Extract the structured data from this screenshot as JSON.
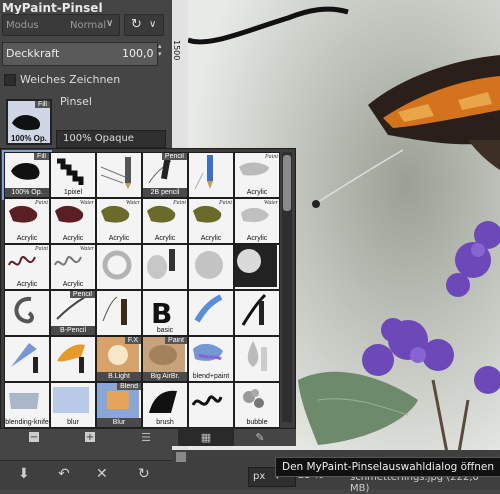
{
  "dock": {
    "title": "MyPaint-Pinsel",
    "mode_label": "Modus",
    "mode_value": "Normal",
    "opacity_label": "Deckkraft",
    "opacity_value": "100,0",
    "soft_label": "Weiches Zeichnen",
    "brush_label": "Pinsel",
    "current_brush_name": "100% Opaque"
  },
  "ruler": {
    "value": "1500"
  },
  "brushes": [
    {
      "label": "100% Op.",
      "badge": "Fill",
      "dark": true,
      "selected": true,
      "icon": "fill-black-icon"
    },
    {
      "label": "1pixel",
      "badge": "",
      "dark": false,
      "icon": "pixel-steps-icon"
    },
    {
      "label": "",
      "badge": "",
      "dark": false,
      "icon": "pencil-strokes-icon"
    },
    {
      "label": "2B pencil",
      "badge": "Pencil",
      "dark": true,
      "icon": "pencil-icon"
    },
    {
      "label": "",
      "badge": "",
      "dark": false,
      "icon": "blue-pencil-icon"
    },
    {
      "label": "Acrylic",
      "badge": "Paint",
      "dark": false,
      "icon": "acrylic-icon"
    },
    {
      "label": "Acrylic",
      "badge": "Paint",
      "dark": false,
      "icon": "acrylic-maroon-icon"
    },
    {
      "label": "Acrylic",
      "badge": "Water",
      "dark": false,
      "icon": "acrylic-maroon-icon"
    },
    {
      "label": "Acrylic",
      "badge": "Water",
      "dark": false,
      "icon": "acrylic-olive-icon"
    },
    {
      "label": "Acrylic",
      "badge": "Paint",
      "dark": false,
      "icon": "acrylic-olive-icon"
    },
    {
      "label": "Acrylic",
      "badge": "Paint",
      "dark": false,
      "icon": "acrylic-olive-icon"
    },
    {
      "label": "Acrylic",
      "badge": "Water",
      "dark": false,
      "icon": "acrylic-gray-icon"
    },
    {
      "label": "Acrylic",
      "badge": "Paint",
      "dark": false,
      "icon": "squiggle-icon"
    },
    {
      "label": "Acrylic",
      "badge": "Water",
      "dark": false,
      "icon": "squiggle-gray-icon"
    },
    {
      "label": "",
      "badge": "",
      "dark": false,
      "icon": "airbrush-swirl-icon"
    },
    {
      "label": "",
      "badge": "",
      "dark": false,
      "icon": "airbrush-tool-icon"
    },
    {
      "label": "",
      "badge": "",
      "dark": false,
      "icon": "airbrush-soft-icon"
    },
    {
      "label": "",
      "badge": "",
      "dark": false,
      "icon": "airbrush-dark-icon"
    },
    {
      "label": "",
      "badge": "",
      "dark": false,
      "icon": "swirl-stroke-icon"
    },
    {
      "label": "B-Pencil",
      "badge": "Pencil",
      "dark": true,
      "icon": "b-pencil-icon"
    },
    {
      "label": "",
      "badge": "",
      "dark": false,
      "icon": "brush-tip-icon"
    },
    {
      "label": "basic",
      "badge": "",
      "dark": false,
      "icon": "basic-b-icon"
    },
    {
      "label": "",
      "badge": "",
      "dark": false,
      "icon": "blue-brush-icon"
    },
    {
      "label": "",
      "badge": "",
      "dark": false,
      "icon": "ink-pen-icon"
    },
    {
      "label": "",
      "badge": "",
      "dark": false,
      "icon": "blue-fan-icon"
    },
    {
      "label": "",
      "badge": "",
      "dark": false,
      "icon": "orange-fan-icon"
    },
    {
      "label": "B.Light",
      "badge": "F.X",
      "dark": true,
      "icon": "blend-light-icon"
    },
    {
      "label": "Big AirBr.",
      "badge": "Paint",
      "dark": true,
      "icon": "big-airbrush-icon"
    },
    {
      "label": "blend+paint",
      "badge": "",
      "dark": false,
      "icon": "blend-paint-icon"
    },
    {
      "label": "",
      "badge": "",
      "dark": false,
      "icon": "water-drop-icon"
    },
    {
      "label": "blending-knife",
      "badge": "",
      "dark": false,
      "icon": "blending-knife-icon"
    },
    {
      "label": "blur",
      "badge": "",
      "dark": false,
      "icon": "blur-icon"
    },
    {
      "label": "Blur",
      "badge": "Blend",
      "dark": true,
      "icon": "blend-blur-icon"
    },
    {
      "label": "brush",
      "badge": "",
      "dark": false,
      "icon": "brush-dark-icon"
    },
    {
      "label": "",
      "badge": "",
      "dark": false,
      "icon": "brush-squiggle-icon"
    },
    {
      "label": "bubble",
      "badge": "",
      "dark": false,
      "icon": "bubble-icon"
    }
  ],
  "popup_bar": {
    "minus": "−",
    "plus": "+",
    "list": "☰",
    "grid": "▦",
    "brush": "✎"
  },
  "dock_buttons": {
    "save": "⬇",
    "undo": "↶",
    "delete": "✕",
    "refresh": "↻"
  },
  "status": {
    "unit": "px",
    "zoom_fragment": "25 %",
    "file_info": "schmetterlings.jpg (222,0 MB)",
    "tooltip": "Den MyPaint-Pinselauswahldialog öffnen"
  },
  "colors": {
    "accent": "#77a3e6",
    "panel": "#454545"
  }
}
